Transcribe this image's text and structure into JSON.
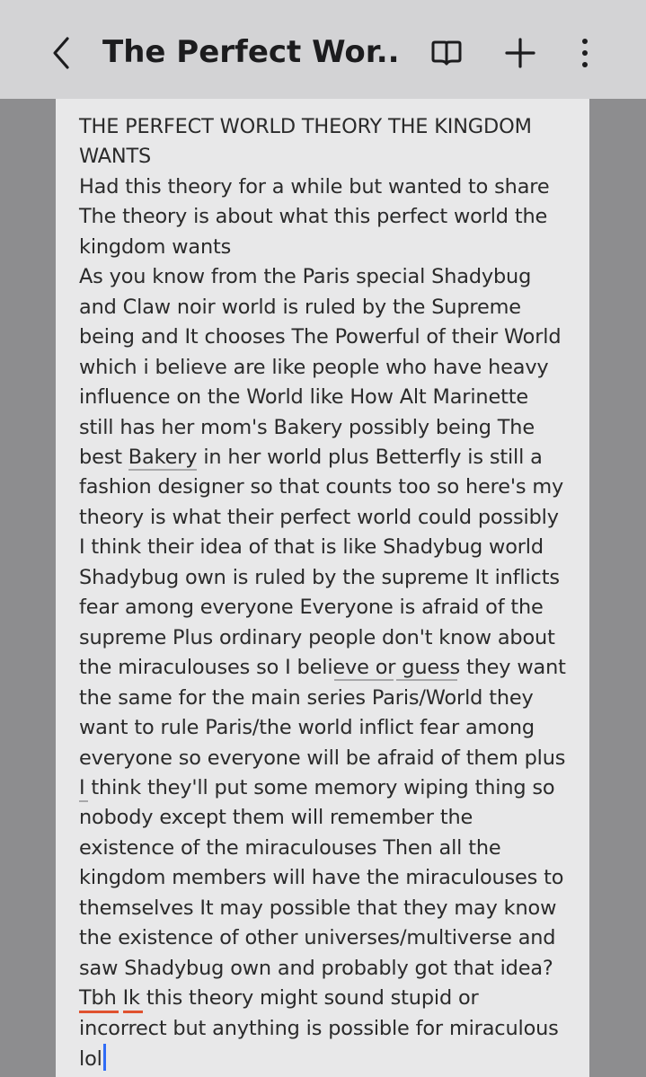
{
  "header": {
    "title": "The Perfect Wor...",
    "back_icon": "chevron-left-icon",
    "reader_icon": "book-open-icon",
    "add_icon": "plus-icon",
    "more_icon": "more-vertical-icon"
  },
  "note": {
    "text": "THE PERFECT WORLD THEORY THE KINGDOM\nWANTS\nHad this theory for a while but wanted to share\nThe theory is about what this perfect world the\nkingdom wants\nAs you know from the Paris special Shadybug\nand Claw noir world is ruled by the Supreme\nbeing and It chooses The Powerful of their World\nwhich i believe are like people who have heavy\ninfluence on the World like How Alt Marinette\nstill has her mom's Bakery possibly being The\nbest Bakery in her world plus Betterfly is still a\nfashion designer so that counts too so here's my\ntheory is what their perfect world could possibly\nI think their idea of that is like Shadybug world\nShadybug own is ruled by the supreme It inflicts\nfear among everyone Everyone is afraid of the\nsupreme Plus ordinary people don't know about\nthe miraculouses so I believe or guess they want\nthe same for the main series Paris/World they\nwant to rule Paris/the world inflict fear among\neveryone so everyone will be afraid of them plus\nI think they'll put some memory wiping thing so\nnobody except them will remember the\nexistence of the miraculouses Then all the\nkingdom members will have the miraculouses to\nthemselves It may possible that they may know\nthe existence of other universes/multiverse and\nsaw Shadybug own and probably got that idea?\nTbh Ik this theory might sound stupid or\nincorrect but anything is possible for miraculous\nlol"
  },
  "colors": {
    "topbar": "#d3d3d5",
    "background": "#8d8d8f",
    "sheet": "#e8e8e9",
    "text": "#2a2a2a",
    "cursor": "#2f6cf6",
    "spellcheck": "#e0522f"
  }
}
